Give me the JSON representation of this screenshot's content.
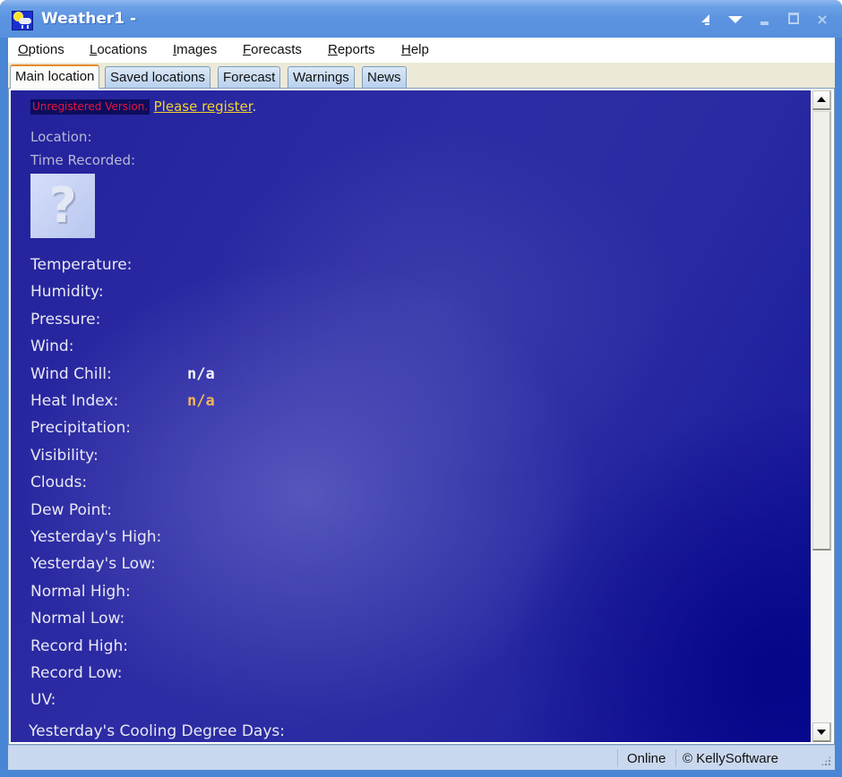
{
  "window": {
    "title": "Weather1 -",
    "icon": "weather-app-icon",
    "controls": [
      {
        "name": "pin-icon"
      },
      {
        "name": "dropdown-icon"
      },
      {
        "name": "minimize-icon"
      },
      {
        "name": "maximize-icon"
      },
      {
        "name": "close-icon",
        "glyph": "×"
      }
    ]
  },
  "menu": {
    "items": [
      {
        "label": "Options",
        "mnemonic": "O",
        "rest": "ptions"
      },
      {
        "label": "Locations",
        "mnemonic": "L",
        "rest": "ocations"
      },
      {
        "label": "Images",
        "mnemonic": "I",
        "rest": "mages"
      },
      {
        "label": "Forecasts",
        "mnemonic": "F",
        "rest": "orecasts"
      },
      {
        "label": "Reports",
        "mnemonic": "R",
        "rest": "eports"
      },
      {
        "label": "Help",
        "mnemonic": "H",
        "rest": "elp"
      }
    ]
  },
  "tabs": [
    {
      "label": "Main location",
      "active": true
    },
    {
      "label": "Saved locations",
      "active": false
    },
    {
      "label": "Forecast",
      "active": false
    },
    {
      "label": "Warnings",
      "active": false
    },
    {
      "label": "News",
      "active": false
    }
  ],
  "registration": {
    "notice": "Unregistered Version.",
    "link": "Please register",
    "punct": "."
  },
  "meta": {
    "location_label": "Location:",
    "location_value": "",
    "time_label": "Time Recorded:",
    "time_value": ""
  },
  "condition_image": {
    "icon": "unknown-condition-icon",
    "glyph": "?"
  },
  "fields": [
    {
      "label": "Temperature:",
      "value": ""
    },
    {
      "label": "Humidity:",
      "value": ""
    },
    {
      "label": "Pressure:",
      "value": ""
    },
    {
      "label": "Wind:",
      "value": ""
    },
    {
      "label": "Wind Chill:",
      "value": "n/a",
      "color": "#f4f4fa"
    },
    {
      "label": "Heat Index:",
      "value": "n/a",
      "color": "#f2b45a"
    },
    {
      "label": "Precipitation:",
      "value": ""
    },
    {
      "label": "Visibility:",
      "value": ""
    },
    {
      "label": "Clouds:",
      "value": ""
    },
    {
      "label": "Dew Point:",
      "value": ""
    },
    {
      "label": "Yesterday's High:",
      "value": ""
    },
    {
      "label": "Yesterday's Low:",
      "value": ""
    },
    {
      "label": "Normal High:",
      "value": ""
    },
    {
      "label": "Normal Low:",
      "value": ""
    },
    {
      "label": "Record High:",
      "value": ""
    },
    {
      "label": "Record Low:",
      "value": ""
    },
    {
      "label": "UV:",
      "value": ""
    }
  ],
  "extra_field": {
    "label": "Yesterday's Cooling Degree Days:",
    "value": ""
  },
  "scrollbar": {
    "position_fraction": 0.0,
    "visible_fraction": 0.72
  },
  "status": {
    "connection": "Online",
    "copyright": "© KellySoftware"
  },
  "colors": {
    "accent_tab": "#e68b2c",
    "unregistered": "#e8163a",
    "register_link": "#f2d32a",
    "heat_index": "#f2b45a",
    "pane_bg": "#2a2ba2"
  }
}
